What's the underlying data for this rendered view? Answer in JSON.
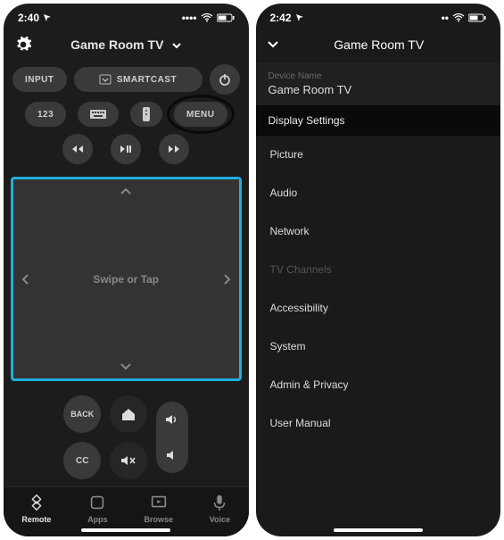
{
  "left": {
    "status": {
      "time": "2:40",
      "location": true
    },
    "title": "Game Room TV",
    "buttons": {
      "input": "INPUT",
      "cast": "SMARTCAST",
      "num": "123",
      "menu": "MENU"
    },
    "touchpad": "Swipe or Tap",
    "back": "BACK",
    "cc": "CC",
    "tabs": {
      "remote": "Remote",
      "apps": "Apps",
      "browse": "Browse",
      "voice": "Voice"
    }
  },
  "right": {
    "status": {
      "time": "2:42",
      "location": true
    },
    "title": "Game Room TV",
    "device_label": "Device Name",
    "device_name": "Game Room TV",
    "section": "Display Settings",
    "items": [
      {
        "label": "Picture",
        "disabled": false
      },
      {
        "label": "Audio",
        "disabled": false
      },
      {
        "label": "Network",
        "disabled": false
      },
      {
        "label": "TV Channels",
        "disabled": true
      },
      {
        "label": "Accessibility",
        "disabled": false
      },
      {
        "label": "System",
        "disabled": false
      },
      {
        "label": "Admin & Privacy",
        "disabled": false
      },
      {
        "label": "User Manual",
        "disabled": false
      }
    ]
  }
}
